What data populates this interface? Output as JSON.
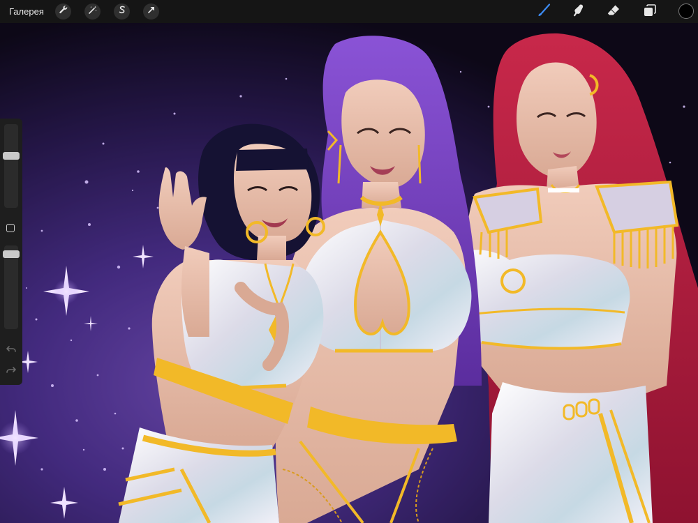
{
  "toolbar": {
    "gallery_label": "Галерея",
    "left_tools": [
      {
        "name": "actions",
        "icon": "wrench-icon"
      },
      {
        "name": "adjustments",
        "icon": "magic-wand-icon"
      },
      {
        "name": "selection",
        "icon": "selection-s-icon"
      },
      {
        "name": "transform",
        "icon": "arrow-cursor-icon"
      }
    ],
    "right_tools": [
      {
        "name": "brush",
        "icon": "brush-icon",
        "active": true
      },
      {
        "name": "smudge",
        "icon": "smudge-finger-icon",
        "active": false
      },
      {
        "name": "eraser",
        "icon": "eraser-icon",
        "active": false
      },
      {
        "name": "layers",
        "icon": "layers-icon",
        "active": false
      }
    ],
    "current_color": "#000000"
  },
  "colors": {
    "toolbar_bg": "#151515",
    "active_tool": "#3d8cf5",
    "inactive_tool": "#e6e6e6",
    "gold": "#f2b928",
    "space_purple": "#7a4fc9"
  },
  "sidebar": {
    "brush_size_level": 0.37,
    "opacity_level": 0.06,
    "modify_icon": "square-modify-icon",
    "undo_icon": "undo-icon",
    "redo_icon": "redo-icon"
  },
  "canvas": {
    "artwork": "illustration-three-women-in-white-and-gold-outfits-space-background"
  }
}
